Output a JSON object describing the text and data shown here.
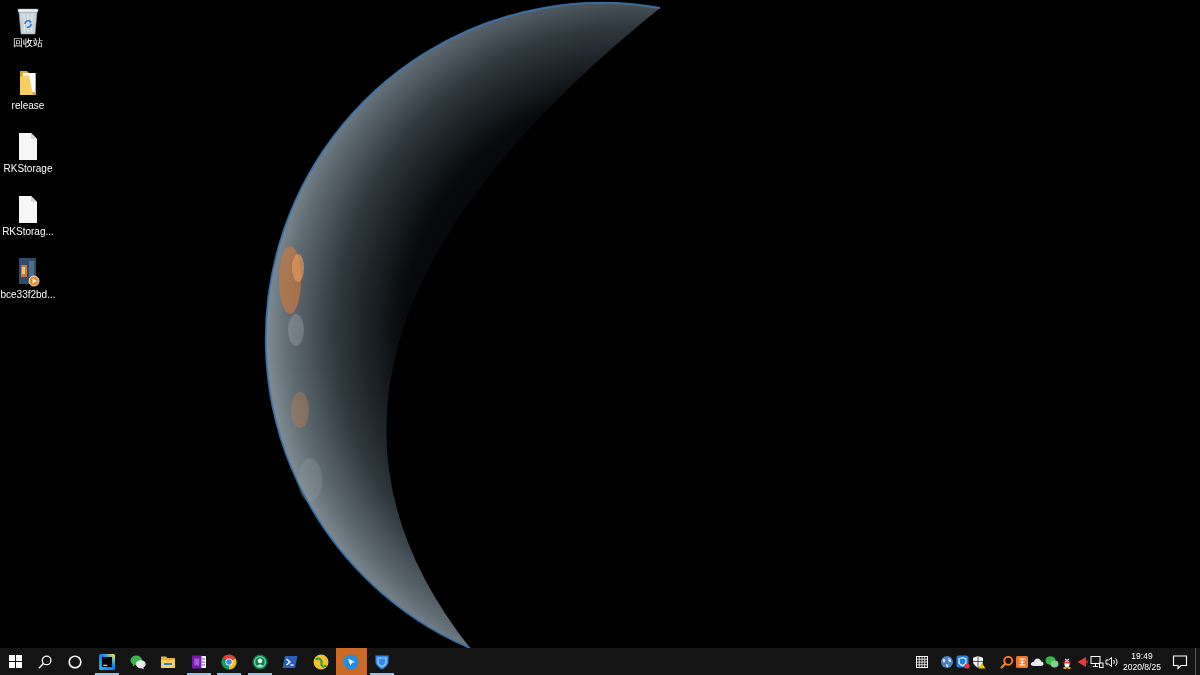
{
  "desktop": {
    "shortcuts": [
      {
        "label": "回收站"
      },
      {
        "label": "release"
      },
      {
        "label": "RKStorage"
      },
      {
        "label": "RKStorag..."
      },
      {
        "label": "bce33f2bd..."
      }
    ]
  },
  "taskbar": {
    "apps": [
      {
        "running": true,
        "flashing": false
      },
      {
        "running": false,
        "flashing": false
      },
      {
        "running": false,
        "flashing": false
      },
      {
        "running": true,
        "flashing": false
      },
      {
        "running": true,
        "flashing": false
      },
      {
        "running": true,
        "flashing": false
      },
      {
        "running": false,
        "flashing": false
      },
      {
        "running": false,
        "flashing": false
      },
      {
        "running": false,
        "flashing": true
      },
      {
        "running": true,
        "flashing": false
      }
    ],
    "clock": {
      "time": "19:49",
      "date": "2020/8/25"
    }
  }
}
